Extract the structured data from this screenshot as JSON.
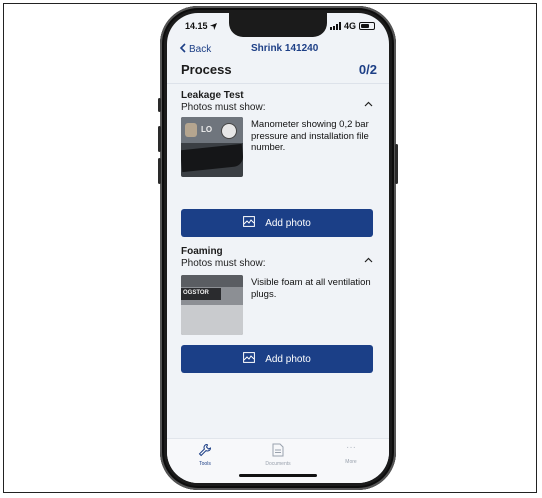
{
  "status": {
    "time": "14.15",
    "network": "4G",
    "battery_level": "83"
  },
  "nav": {
    "back_label": "Back",
    "title": "Shrink 141240"
  },
  "process": {
    "title": "Process",
    "progress": "0/2"
  },
  "sections": [
    {
      "title": "Leakage Test",
      "subtitle": "Photos must show:",
      "description": "Manometer showing 0,2 bar pressure and installation file number.",
      "thumb_text": "LO",
      "button_label": "Add photo"
    },
    {
      "title": "Foaming",
      "subtitle": "Photos must show:",
      "description": "Visible foam at all ventilation plugs.",
      "thumb_text": "OGSTOR",
      "button_label": "Add photo"
    }
  ],
  "tabbar": {
    "tools": "Tools",
    "documents": "Documents",
    "more": "More"
  },
  "colors": {
    "primary": "#1b3f87",
    "background": "#f0f3f7"
  },
  "icons": [
    "location-arrow-icon",
    "signal-icon",
    "battery-icon",
    "chevron-left-icon",
    "chevron-up-icon",
    "image-icon",
    "wrench-icon",
    "document-icon",
    "more-dots-icon"
  ]
}
